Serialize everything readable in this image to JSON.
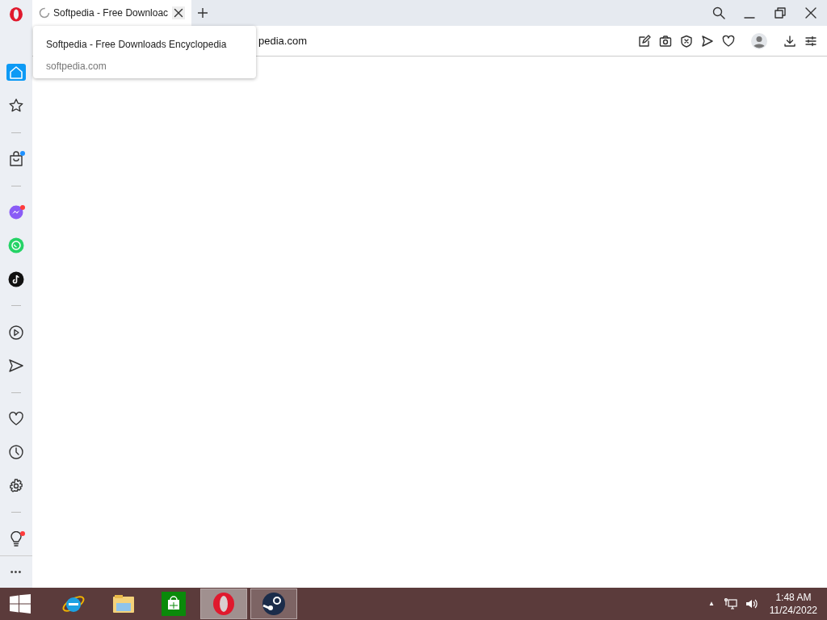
{
  "tabs": [
    {
      "title": "Softpedia - Free Downloac",
      "loading": true,
      "selected": true
    }
  ],
  "address_bar": {
    "value": "pedia.com"
  },
  "tooltip": {
    "title": "Softpedia - Free Downloads Encyclopedia",
    "url": "softpedia.com"
  },
  "toolbar": [
    {
      "kind": "edit"
    },
    {
      "kind": "camera"
    },
    {
      "kind": "shield"
    },
    {
      "kind": "send"
    },
    {
      "kind": "heart"
    },
    {
      "kind": "account"
    },
    {
      "kind": "download"
    },
    {
      "kind": "settings"
    }
  ],
  "sidebar": {
    "items": [
      {
        "kind": "home",
        "selected": true
      },
      {
        "kind": "star",
        "selected": false
      },
      {
        "kind": "separator"
      },
      {
        "kind": "bag",
        "selected": false,
        "color": "#1e90ff"
      },
      {
        "kind": "separator"
      },
      {
        "kind": "messenger",
        "selected": false,
        "color": "#ff3b3b"
      },
      {
        "kind": "whatsapp",
        "selected": false
      },
      {
        "kind": "tiktok",
        "selected": false
      },
      {
        "kind": "separator"
      },
      {
        "kind": "play",
        "selected": false
      },
      {
        "kind": "send",
        "selected": false
      },
      {
        "kind": "separator"
      },
      {
        "kind": "heart",
        "selected": false
      },
      {
        "kind": "clock",
        "selected": false
      },
      {
        "kind": "gear",
        "selected": false
      },
      {
        "kind": "separator"
      },
      {
        "kind": "bulb",
        "selected": false,
        "color": "#ff3b3b"
      }
    ],
    "more": "•••"
  },
  "taskbar": {
    "apps": [
      {
        "kind": "ie",
        "open": false,
        "selected": false
      },
      {
        "kind": "explorer",
        "open": false,
        "selected": false
      },
      {
        "kind": "store",
        "open": false,
        "selected": false
      },
      {
        "kind": "opera",
        "open": true,
        "selected": true
      },
      {
        "kind": "steam",
        "open": true,
        "selected": false
      }
    ],
    "tray_arrow": "▲",
    "time": "1:48 AM",
    "date": "11/24/2022"
  }
}
